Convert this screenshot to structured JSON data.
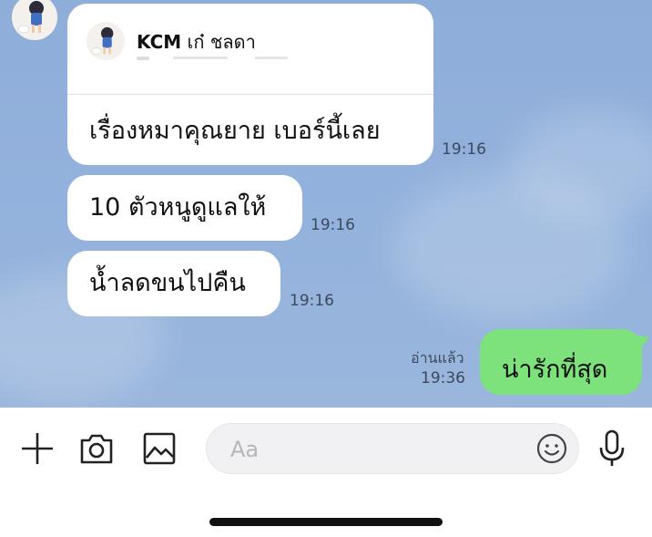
{
  "reply_preview": {
    "sender_name": "KCM",
    "sender_detail": "เก๋ ชลดา"
  },
  "messages": [
    {
      "text": "เรื่องหมาคุณยาย เบอร์นี้เลย",
      "time": "19:16"
    },
    {
      "text": "10 ตัวหนูดูแลให้",
      "time": "19:16"
    },
    {
      "text": "น้ำลดขนไปคืน",
      "time": "19:16"
    }
  ],
  "sent_message": {
    "text": "น่ารักที่สุด",
    "read_label": "อ่านแล้ว",
    "time": "19:36"
  },
  "composer": {
    "placeholder": "Aa"
  },
  "colors": {
    "chat_background": "#93b2dc",
    "sent_bubble": "#7de27b",
    "received_bubble": "#ffffff"
  },
  "icons": [
    "plus-icon",
    "camera-icon",
    "image-icon",
    "emoji-icon",
    "microphone-icon"
  ]
}
